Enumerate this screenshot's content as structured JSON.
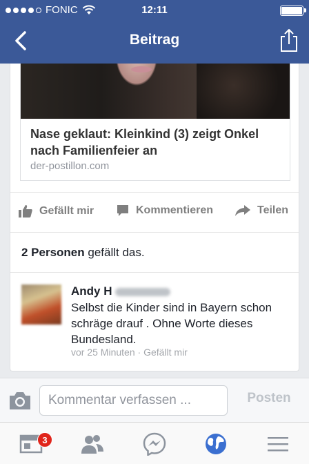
{
  "status_bar": {
    "carrier": "FONIC",
    "time": "12:11"
  },
  "nav": {
    "title": "Beitrag"
  },
  "post": {
    "link_title": "Nase geklaut: Kleinkind (3) zeigt Onkel nach Familienfeier an",
    "link_domain": "der-postillon.com"
  },
  "actions": {
    "like": "Gefällt mir",
    "comment": "Kommentieren",
    "share": "Teilen"
  },
  "likes": {
    "count_text": "2 Personen",
    "suffix": "gefällt das."
  },
  "comment": {
    "author_visible": "Andy H",
    "text": "Selbst die Kinder sind in Bayern schon schräge drauf . Ohne Worte dieses Bundesland.",
    "time": "vor 25 Minuten",
    "separator": "·",
    "like_link": "Gefällt mir"
  },
  "composer": {
    "placeholder": "Kommentar verfassen ...",
    "post_label": "Posten"
  },
  "tabbar": {
    "news_badge": "3"
  },
  "colors": {
    "brand": "#3b5998",
    "badge": "#e0251b"
  }
}
